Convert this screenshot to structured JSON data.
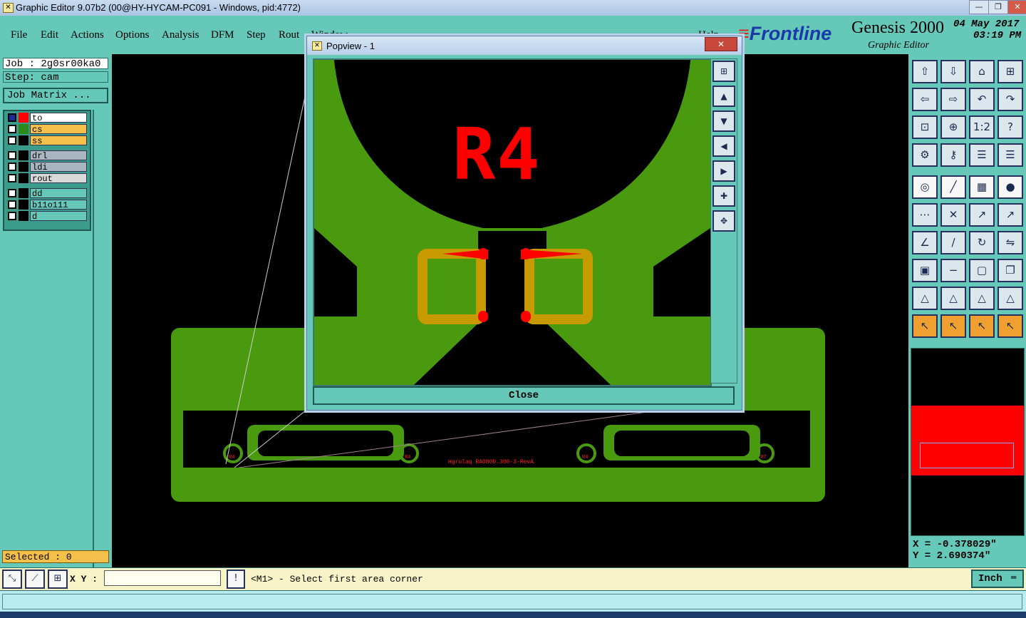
{
  "window": {
    "title": "Graphic Editor 9.07b2 (00@HY-HYCAM-PC091 - Windows, pid:4772)"
  },
  "menu": {
    "items": [
      "File",
      "Edit",
      "Actions",
      "Options",
      "Analysis",
      "DFM",
      "Step",
      "Rout",
      "Window",
      "Help"
    ]
  },
  "brand": {
    "logo": "Frontline",
    "product": "Genesis 2000",
    "subtitle": "Graphic Editor",
    "date": "04 May 2017",
    "time": "03:19 PM"
  },
  "job": {
    "job_label": "Job : 2g0sr00ka0",
    "step_label": "Step: cam",
    "matrix_button": "Job Matrix ..."
  },
  "layers": [
    {
      "name": "to",
      "color": "#ff0000",
      "bg": "#ffffff"
    },
    {
      "name": "cs",
      "color": "#2c8a1c",
      "bg": "#f5c04a"
    },
    {
      "name": "ss",
      "color": "#000000",
      "bg": "#f5c04a"
    },
    {
      "name": "drl",
      "color": "#000000",
      "bg": "#a9b6bf"
    },
    {
      "name": "ldi",
      "color": "#000000",
      "bg": "#a9b6bf"
    },
    {
      "name": "rout",
      "color": "#000000",
      "bg": "#d9d9d9"
    },
    {
      "name": "dd",
      "color": "#000000",
      "bg": "#66c8b8"
    },
    {
      "name": "b11o111",
      "color": "#000000",
      "bg": "#66c8b8"
    },
    {
      "name": "d",
      "color": "#000000",
      "bg": "#66c8b8"
    }
  ],
  "selected": "Selected : 0",
  "popview": {
    "title": "Popview - 1",
    "label": "R4",
    "close_label": "Close"
  },
  "board": {
    "silk_text": "Hgrulaq RA0800.300-3-RevA",
    "ref_labels": [
      "R4",
      "R4",
      "R4",
      "R7"
    ]
  },
  "coords": {
    "x": "X = -0.378029\"",
    "y": "Y = 2.690374\""
  },
  "status": {
    "xy_label": "X Y :",
    "xy_value": "",
    "message": "<M1> - Select first area corner",
    "units": "Inch"
  },
  "colors": {
    "teal": "#66c8b8",
    "copper": "#4a9a10",
    "silk": "#ff0000",
    "pad": "#c79a00"
  }
}
